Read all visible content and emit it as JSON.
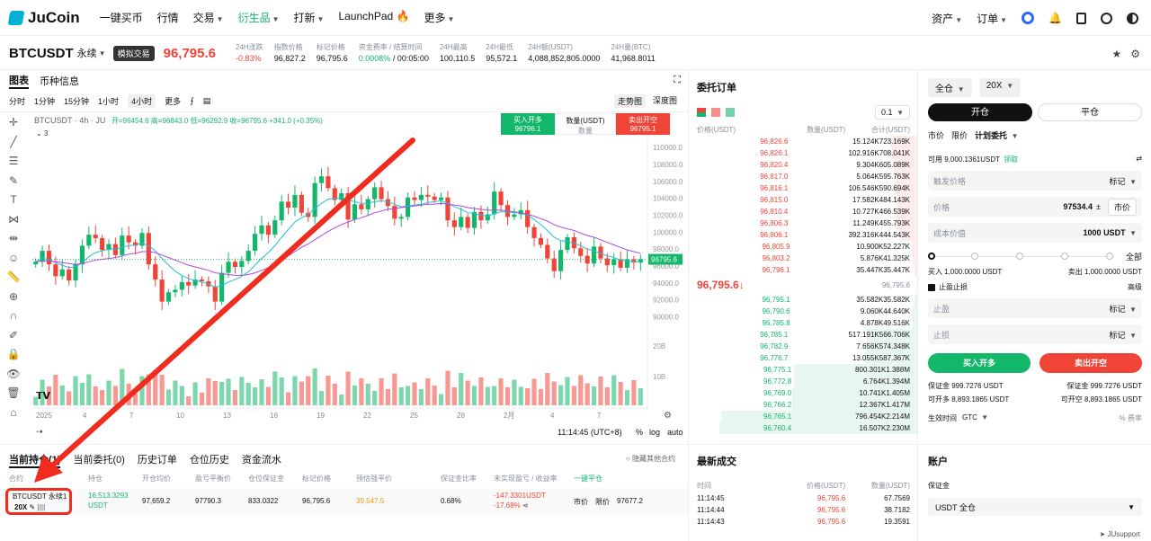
{
  "nav": {
    "logo": "JuCoin",
    "items": [
      {
        "label": "一键买币",
        "dropdown": false,
        "active": false
      },
      {
        "label": "行情",
        "dropdown": false,
        "active": false
      },
      {
        "label": "交易",
        "dropdown": true,
        "active": false
      },
      {
        "label": "衍生品",
        "dropdown": true,
        "active": true
      },
      {
        "label": "打新",
        "dropdown": true,
        "active": false
      },
      {
        "label": "LaunchPad 🔥",
        "dropdown": false,
        "active": false
      },
      {
        "label": "更多",
        "dropdown": true,
        "active": false
      }
    ],
    "assets": "资产",
    "orders": "订单"
  },
  "ticker": {
    "symbol": "BTCUSDT",
    "contract": "永续",
    "mode": "模拟交易",
    "price": "96,795.6",
    "stats": [
      {
        "label": "24H涨跌",
        "value": "-0.83%",
        "color": "red"
      },
      {
        "label": "指数价格",
        "value": "96,827.2",
        "color": ""
      },
      {
        "label": "标记价格",
        "value": "96,795.6",
        "color": ""
      },
      {
        "label": "资金费率 / 结算时间",
        "value": "0.0008% / 00:05:00",
        "color": "split"
      },
      {
        "label": "24H最高",
        "value": "100,110.5",
        "color": ""
      },
      {
        "label": "24H最低",
        "value": "95,572.1",
        "color": ""
      },
      {
        "label": "24H额(USDT)",
        "value": "4,088,852,805.0000",
        "color": ""
      },
      {
        "label": "24H量(BTC)",
        "value": "41,968.8011",
        "color": ""
      }
    ],
    "funding_rate": "0.0008%",
    "settle_time": " / 00:05:00"
  },
  "chart_tabs": [
    "图表",
    "币种信息"
  ],
  "timeframes": [
    "分时",
    "1分钟",
    "15分钟",
    "1小时",
    "4小时",
    "更多"
  ],
  "active_timeframe": "4小时",
  "views": [
    "走势图",
    "深度图"
  ],
  "legend": {
    "title": "BTCUSDT · 4h · JU",
    "ohlc": "开=96454.6  高=96843.0  低=96292.9  收=96795.6  +341.0 (+0.35%)",
    "indicators": "3"
  },
  "quick_order": {
    "buy_label": "买入开多",
    "buy_price": "96796.1",
    "qty_label": "数量(USDT)",
    "qty_placeholder": "数量",
    "sell_label": "卖出开空",
    "sell_price": "96795.1"
  },
  "chart_data": {
    "type": "candlestick",
    "title": "BTCUSDT · 4h · JU",
    "y_ticks": [
      "110000.0",
      "108000.0",
      "106000.0",
      "104000.0",
      "102000.0",
      "100000.0",
      "98000.0",
      "96000.0",
      "94000.0",
      "92000.0",
      "90000.0"
    ],
    "volume_ticks": [
      "20B",
      "10B"
    ],
    "x_ticks": [
      "2025",
      "4",
      "7",
      "10",
      "13",
      "16",
      "19",
      "22",
      "25",
      "28",
      "2月",
      "4",
      "7"
    ],
    "current_price": "96795.6",
    "close_series": [
      96500,
      97800,
      96200,
      94800,
      95600,
      94300,
      96200,
      98400,
      99700,
      99300,
      97900,
      98600,
      97300,
      99600,
      98800,
      98400,
      99900,
      96200,
      94400,
      91800,
      92900,
      93200,
      94100,
      93700,
      94400,
      94200,
      93600,
      91800,
      95200,
      96500,
      95900,
      96600,
      97800,
      99800,
      100800,
      99700,
      101400,
      103600,
      102900,
      104400,
      102300,
      101800,
      105800,
      106600,
      105200,
      103800,
      104600,
      101500,
      103300,
      102700,
      103900,
      105300,
      103900,
      103100,
      101600,
      101800,
      104100,
      103800,
      104400,
      104200,
      103800,
      104100,
      101400,
      100600,
      101800,
      100500,
      102400,
      101400,
      102100,
      104800,
      103200,
      101800,
      102100,
      102600,
      100600,
      99300,
      98500,
      96900,
      95400,
      97900,
      99400,
      98100,
      97200,
      96300,
      98300,
      96900,
      96100,
      96800,
      95800,
      96800,
      96400,
      96800
    ],
    "ma_fast": [
      96500,
      96900,
      96800,
      96400,
      96100,
      95800,
      95900,
      96400,
      97100,
      97600,
      97800,
      98000,
      98000,
      98200,
      98400,
      98500,
      98700,
      98400,
      97800,
      96900,
      96100,
      95400,
      94900,
      94500,
      94300,
      94100,
      93900,
      93500,
      93700,
      94100,
      94400,
      94800,
      95300,
      96100,
      96900,
      97600,
      98400,
      99400,
      100300,
      101200,
      101700,
      102100,
      102800,
      103400,
      103900,
      104000,
      104100,
      103800,
      103600,
      103400,
      103400,
      103600,
      103700,
      103600,
      103300,
      103000,
      103100,
      103200,
      103300,
      103500,
      103600,
      103700,
      103400,
      103000,
      102700,
      102300,
      102200,
      102000,
      101900,
      102200,
      102400,
      102400,
      102300,
      102300,
      102000,
      101500,
      100900,
      100200,
      99400,
      99000,
      98900,
      98700,
      98400,
      98000,
      97800,
      97500,
      97200,
      97000,
      96700,
      96600,
      96500,
      96500
    ],
    "ma_slow": [
      96500,
      96600,
      96600,
      96500,
      96400,
      96300,
      96200,
      96300,
      96500,
      96700,
      96800,
      96900,
      97000,
      97200,
      97400,
      97500,
      97700,
      97700,
      97600,
      97300,
      97000,
      96700,
      96400,
      96100,
      95900,
      95700,
      95500,
      95200,
      95100,
      95000,
      94900,
      94900,
      95000,
      95200,
      95500,
      95800,
      96200,
      96700,
      97200,
      97700,
      98200,
      98600,
      99100,
      99600,
      100100,
      100500,
      100900,
      101200,
      101500,
      101700,
      102000,
      102300,
      102500,
      102700,
      102800,
      102900,
      103000,
      103100,
      103200,
      103300,
      103300,
      103400,
      103300,
      103200,
      103100,
      102900,
      102800,
      102700,
      102600,
      102600,
      102600,
      102500,
      102400,
      102300,
      102100,
      101900,
      101600,
      101300,
      100900,
      100600,
      100400,
      100200,
      99900,
      99600,
      99400,
      99100,
      98800,
      98500,
      98200,
      97900,
      97700,
      97500
    ],
    "ylim": [
      89000,
      111500
    ]
  },
  "chart_footer": {
    "time": "11:14:45 (UTC+8)",
    "pct": "%",
    "log": "log",
    "auto": "auto"
  },
  "orderbook": {
    "title": "委托订单",
    "precision": "0.1",
    "headers": [
      "价格(USDT)",
      "数量(USDT)",
      "合计(USDT)"
    ],
    "asks": [
      {
        "p": "96,826.6",
        "q": "15.124K",
        "t": "723.169K",
        "d": 0.12
      },
      {
        "p": "96,826.1",
        "q": "102.916K",
        "t": "708.041K",
        "d": 0.11
      },
      {
        "p": "96,820.4",
        "q": "9.304K",
        "t": "605.089K",
        "d": 0.1
      },
      {
        "p": "96,817.0",
        "q": "5.064K",
        "t": "595.763K",
        "d": 0.1
      },
      {
        "p": "96,816.1",
        "q": "106.546K",
        "t": "590.694K",
        "d": 0.1
      },
      {
        "p": "96,815.0",
        "q": "17.582K",
        "t": "484.143K",
        "d": 0.09
      },
      {
        "p": "96,810.4",
        "q": "10.727K",
        "t": "466.539K",
        "d": 0.09
      },
      {
        "p": "96,806.3",
        "q": "11.249K",
        "t": "455.793K",
        "d": 0.09
      },
      {
        "p": "96,806.1",
        "q": "392.316K",
        "t": "444.543K",
        "d": 0.08
      },
      {
        "p": "96,805.9",
        "q": "10.900K",
        "t": "52.227K",
        "d": 0.02
      },
      {
        "p": "96,803.2",
        "q": "5.876K",
        "t": "41.325K",
        "d": 0.02
      },
      {
        "p": "96,796.1",
        "q": "35.447K",
        "t": "35.447K",
        "d": 0.01
      }
    ],
    "mid_price": "96,795.6",
    "mid_arrow": "↓",
    "mark_price": "96,795.6",
    "bids": [
      {
        "p": "96,795.1",
        "q": "35.582K",
        "t": "35.582K",
        "d": 0.01
      },
      {
        "p": "96,790.6",
        "q": "9.060K",
        "t": "44.640K",
        "d": 0.02
      },
      {
        "p": "96,785.8",
        "q": "4.878K",
        "t": "49.516K",
        "d": 0.02
      },
      {
        "p": "96,785.1",
        "q": "517.191K",
        "t": "566.706K",
        "d": 0.22
      },
      {
        "p": "96,782.9",
        "q": "7.656K",
        "t": "574.348K",
        "d": 0.22
      },
      {
        "p": "96,776.7",
        "q": "13.055K",
        "t": "587.367K",
        "d": 0.23
      },
      {
        "p": "96,775.1",
        "q": "800.301K",
        "t": "1.388M",
        "d": 0.54
      },
      {
        "p": "96,772.8",
        "q": "6.764K",
        "t": "1.394M",
        "d": 0.54
      },
      {
        "p": "96,769.0",
        "q": "10.741K",
        "t": "1.405M",
        "d": 0.55
      },
      {
        "p": "96,766.2",
        "q": "12.367K",
        "t": "1.417M",
        "d": 0.55
      },
      {
        "p": "96,765.1",
        "q": "796.454K",
        "t": "2.214M",
        "d": 0.86
      },
      {
        "p": "96,760.4",
        "q": "16.507K",
        "t": "2.230M",
        "d": 0.87
      }
    ]
  },
  "trade": {
    "margin_mode": "全仓",
    "leverage": "20X",
    "open_label": "开仓",
    "close_label": "平仓",
    "order_types": [
      "市价",
      "限价",
      "计划委托"
    ],
    "available_label": "可用 9,000.1361USDT",
    "claim": "领取",
    "trigger_label": "触发价格",
    "trigger_type": "标记",
    "price_label": "价格",
    "price_value": "97534.4",
    "market_btn": "市价",
    "cost_label": "成本价值",
    "cost_value": "1000",
    "cost_unit": "USDT",
    "all_label": "全部",
    "buy_max": "买入 1,000.0000 USDT",
    "sell_max": "卖出 1,000.0000 USDT",
    "tpsl_label": "止盈止损",
    "advanced": "高级",
    "tp_label": "止盈",
    "sl_label": "止损",
    "mark": "标记",
    "buy_btn": "买入开多",
    "sell_btn": "卖出开空",
    "margin_left": "保证金 999.7276 USDT",
    "margin_right": "保证金 999.7276 USDT",
    "open_left": "可开多 8,893.1865  USDT",
    "open_right": "可开空 8,893.1865  USDT",
    "tif_label": "生效时间",
    "tif_value": "GTC",
    "fee_label": "费率"
  },
  "positions": {
    "tabs": [
      "当前持仓(1)",
      "当前委托(0)",
      "历史订单",
      "仓位历史",
      "资金流水"
    ],
    "hide_other": "隐藏其他合约",
    "headers": [
      "合约",
      "持仓",
      "开仓均价",
      "盈亏平衡价",
      "仓位保证金",
      "标记价格",
      "预估强平价",
      "保证金比率",
      "未实现盈亏 / 收益率",
      "一键平仓"
    ],
    "row": {
      "symbol": "BTCUSDT 永续1",
      "leverage": "20X",
      "size": "16,513.3293",
      "size_unit": "USDT",
      "entry": "97,659.2",
      "breakeven": "97790.3",
      "margin": "833.0322",
      "mark": "96,795.6",
      "liq": "39,547.5",
      "ratio": "0.68%",
      "pnl": "-147.3301USDT",
      "roe": "-17.68%",
      "market": "市价",
      "limit": "限价",
      "limit_price": "97677.2"
    }
  },
  "trades": {
    "title": "最新成交",
    "headers": [
      "时间",
      "价格(USDT)",
      "数量(USDT)"
    ],
    "rows": [
      {
        "t": "11:14:45",
        "p": "96,795.6",
        "q": "67.7569"
      },
      {
        "t": "11:14:44",
        "p": "96,795.6",
        "q": "38.7182"
      },
      {
        "t": "11:14:43",
        "p": "96,795.6",
        "q": "19.3591"
      }
    ]
  },
  "account": {
    "title": "账户",
    "margin_label": "保证金",
    "select_value": "USDT 全仓",
    "support": "JUsupport"
  },
  "colors": {
    "up": "#12b76a",
    "down": "#f04438",
    "annotation": "#f02c1f"
  }
}
